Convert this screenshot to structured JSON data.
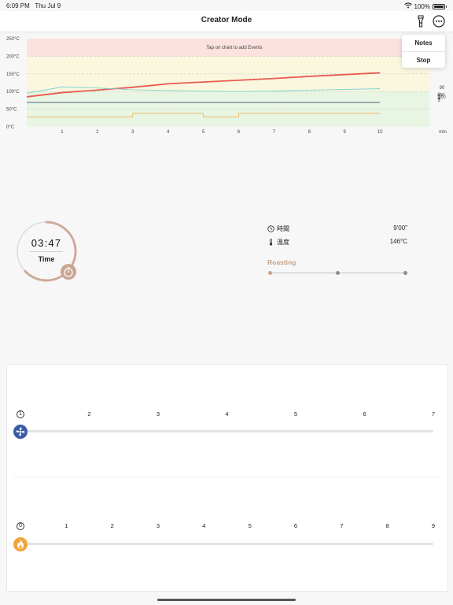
{
  "status_bar": {
    "time": "6:09 PM",
    "date": "Thu Jul 9",
    "battery": "100%",
    "battery_level": 1.0
  },
  "nav": {
    "title": "Creator Mode"
  },
  "menu": {
    "items": [
      {
        "label": "Notes"
      },
      {
        "label": "Stop"
      }
    ]
  },
  "chart_data": {
    "type": "line",
    "annotation": "Tap on chart to add Events",
    "xlabel": "min",
    "y_ticks": [
      "250°C",
      "200°C",
      "150°C",
      "100°C",
      "50°C",
      "0°C"
    ],
    "x_ticks": [
      "1",
      "2",
      "3",
      "4",
      "5",
      "6",
      "7",
      "8",
      "9",
      "10"
    ],
    "xlim": [
      0,
      11.4
    ],
    "ylim": [
      0,
      250
    ],
    "zones": [
      {
        "from": 200,
        "to": 250,
        "color": "#fbe1df"
      },
      {
        "from": 100,
        "to": 200,
        "color": "#fbf7df"
      },
      {
        "from": 0,
        "to": 100,
        "color": "#e9f5e3"
      }
    ],
    "series": [
      {
        "color": "#e85a4f",
        "x": [
          0,
          1,
          2,
          3,
          4,
          5,
          6,
          7,
          8,
          9,
          10
        ],
        "y": [
          85,
          97,
          104,
          112,
          122,
          127,
          132,
          137,
          143,
          148,
          153
        ]
      },
      {
        "color": "#7ed3cf",
        "x": [
          0,
          1,
          2,
          3,
          4,
          5,
          6,
          7,
          8,
          9,
          10
        ],
        "y": [
          95,
          113,
          110,
          105,
          103,
          101,
          100,
          101,
          104,
          106,
          108
        ]
      },
      {
        "color": "#3d4f7c",
        "x": [
          0,
          10
        ],
        "y": [
          69,
          69
        ]
      },
      {
        "color": "#f0b25a",
        "x": [
          0,
          3,
          3,
          5,
          5,
          6,
          6,
          10
        ],
        "y": [
          28,
          28,
          38,
          38,
          28,
          28,
          38,
          38
        ]
      }
    ],
    "side_labels": [
      "90",
      "110",
      "90",
      "6",
      "0",
      "2",
      "4",
      "3"
    ]
  },
  "timer": {
    "value": "03:47",
    "label": "Time",
    "progress": 0.63
  },
  "info": {
    "rows": [
      {
        "label": "時間",
        "value": "9'00\"",
        "icon": "clock-icon"
      },
      {
        "label": "溫度",
        "value": "146°C",
        "icon": "thermometer-icon"
      }
    ]
  },
  "stage": {
    "label": "Roasting",
    "levels": [
      0,
      0.5,
      1
    ]
  },
  "fan_control": {
    "ticks": [
      "1",
      "2",
      "3",
      "4",
      "5",
      "6",
      "7"
    ],
    "level": 1,
    "icon": "fan-icon"
  },
  "heat_control": {
    "ticks": [
      "0",
      "1",
      "2",
      "3",
      "4",
      "5",
      "6",
      "7",
      "8",
      "9"
    ],
    "level": 0,
    "icon": "flame-icon"
  },
  "colors": {
    "accent": "#c3a38c",
    "fan": "#3b5aa8",
    "heat": "#f2a33a",
    "temp_line": "#e85a4f"
  }
}
